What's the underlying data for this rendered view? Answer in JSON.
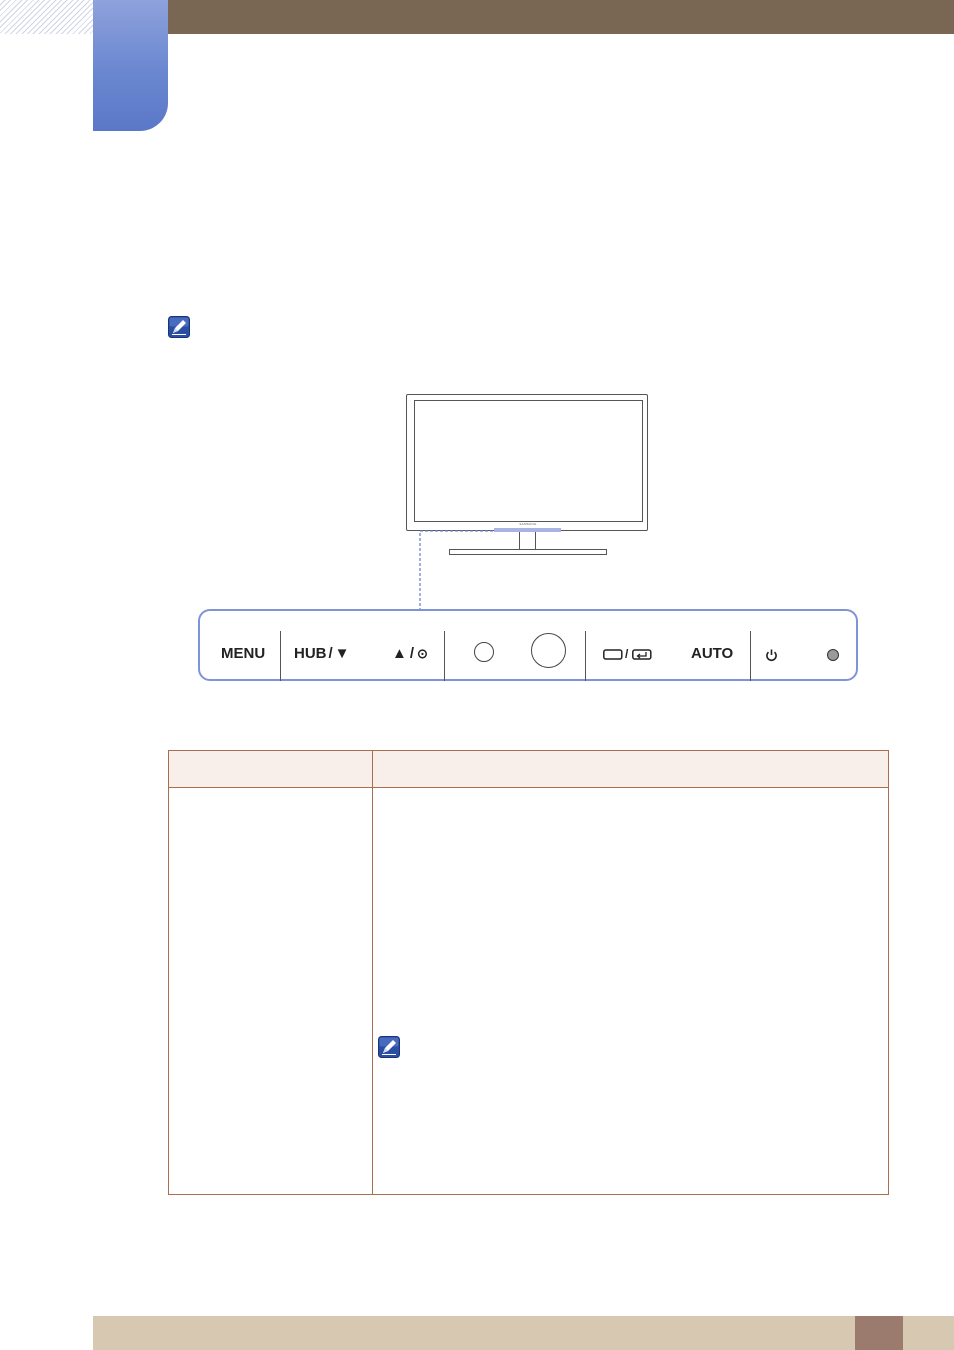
{
  "colors": {
    "header_bar": "#7a6753",
    "chapter_tab": "#6a87d0",
    "panel_border": "#7f93d8",
    "table_border": "#a86e4d",
    "table_header_bg": "#f9efea",
    "footer_bar": "#d7c8b1",
    "page_block": "#9a7b6e"
  },
  "icons": {
    "note": "note-pencil-icon",
    "power": "power-icon",
    "source": "source-enter-icon",
    "up_brightness": "up-arrow-brightness-icon",
    "down": "down-arrow-icon"
  },
  "monitor": {
    "brand": "SAMSUNG"
  },
  "control_panel": {
    "menu_label": "MENU",
    "hub_label": "HUB",
    "hub_separator": "/",
    "down_symbol": "▼",
    "up_symbol": "▲",
    "up_separator": "/",
    "brightness_symbol": "⊙",
    "source_separator": "/",
    "auto_label": "AUTO"
  }
}
